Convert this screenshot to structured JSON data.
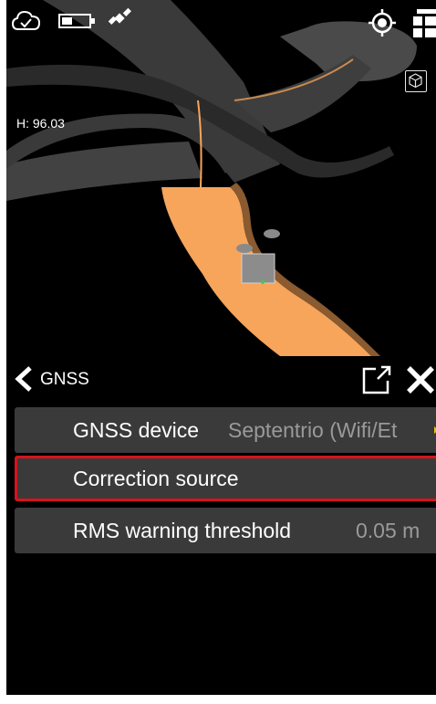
{
  "map": {
    "height_readout": "H: 96.03",
    "icons": [
      "cloud-check-icon",
      "battery-icon",
      "satellite-icon",
      "locate-target-icon",
      "layers-icon",
      "cube-view-icon"
    ]
  },
  "panel": {
    "title": "GNSS",
    "rows": [
      {
        "label": "GNSS device",
        "value": "Septentrio (Wifi/Et"
      },
      {
        "label": "Correction source",
        "value": ""
      },
      {
        "label": "RMS warning threshold",
        "value": "0.05 m"
      }
    ]
  },
  "colors": {
    "road_surface": "#f6a55b",
    "road_dark": "#3c3c3c",
    "row_background": "#3a3a3a",
    "highlight_border": "#d8131b",
    "value_text": "#9a9a9a",
    "arrow_accent": "#e8c400"
  }
}
